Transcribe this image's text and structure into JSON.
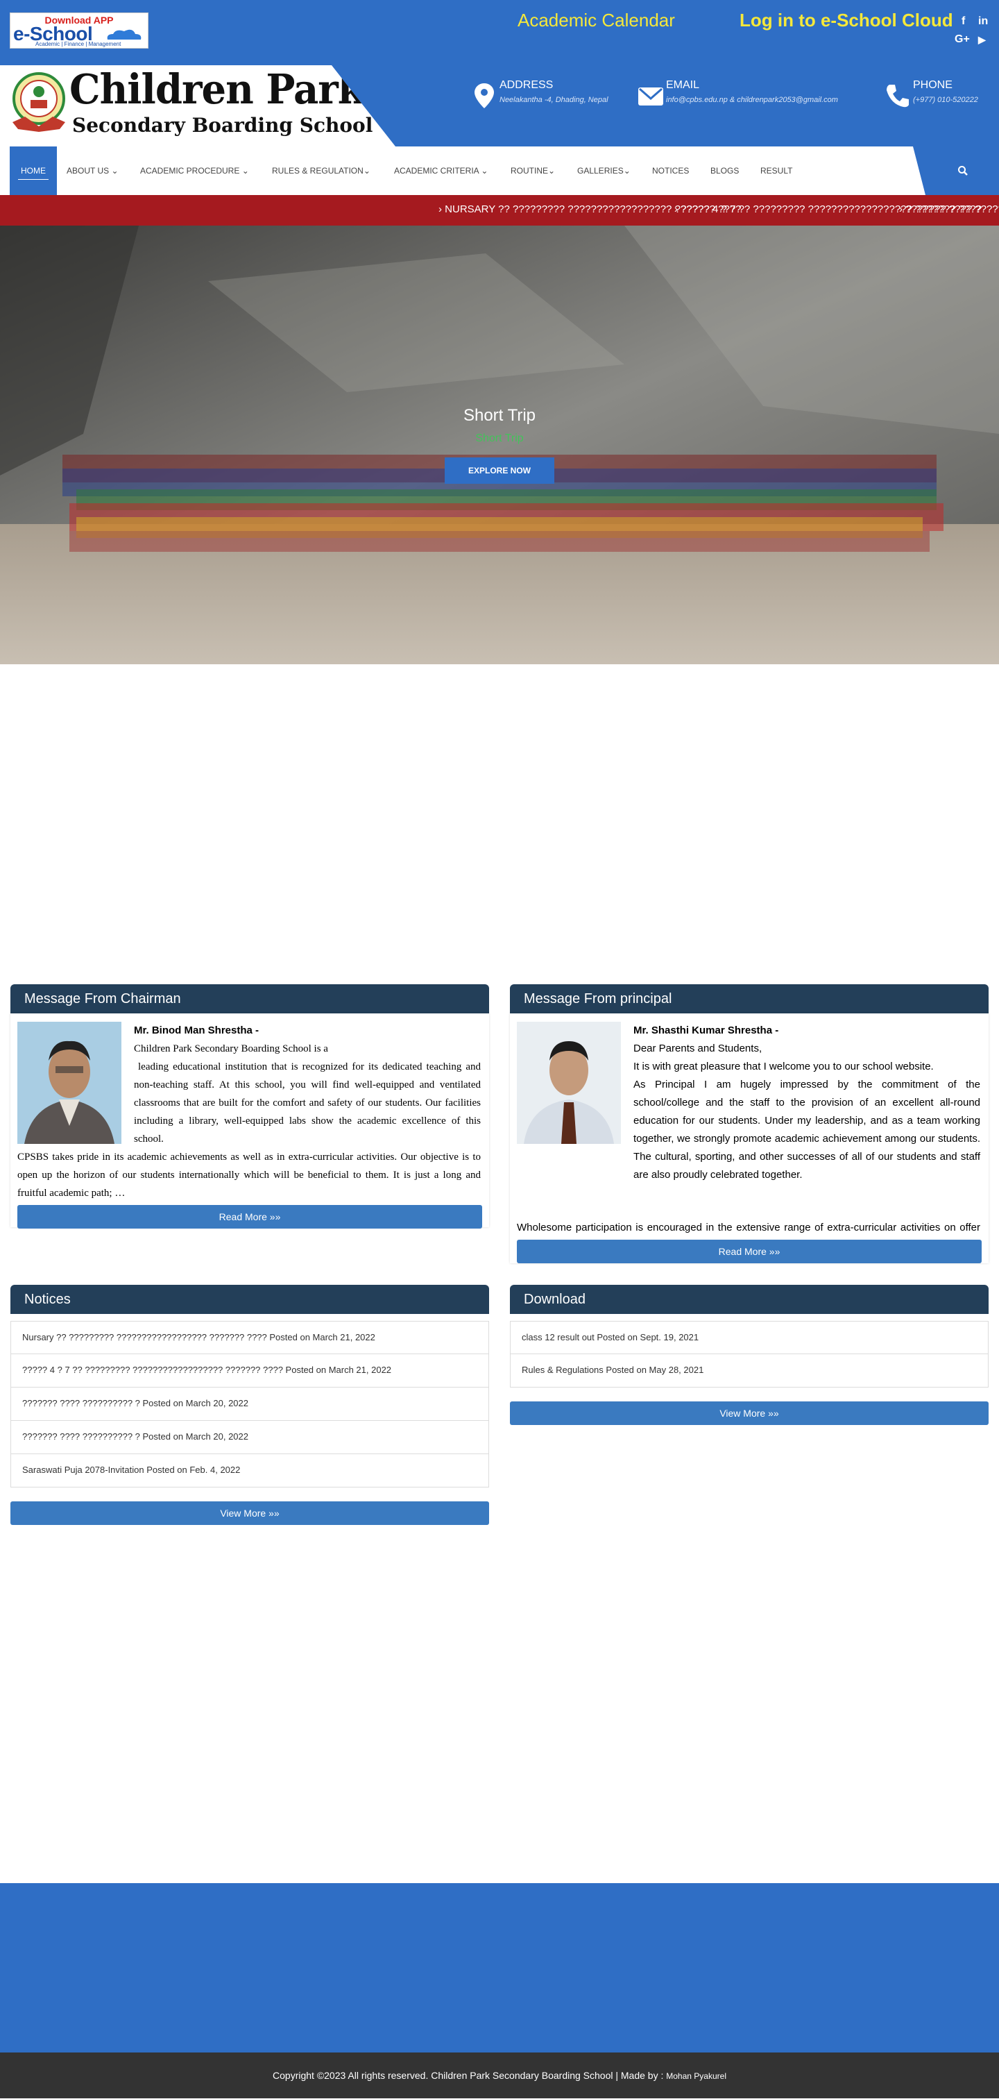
{
  "topbar": {
    "app_badge": {
      "line1": "Download APP",
      "line2": "e-School",
      "line3": "Academic | Finance | Management"
    },
    "academic_calendar": "Academic Calendar",
    "login": "Log in to e-School Cloud",
    "social": {
      "facebook": "f",
      "linkedin": "in",
      "google_plus": "G+",
      "youtube": "▶"
    }
  },
  "header": {
    "school_name_line1": "Children Park",
    "school_name_line2": "Secondary Boarding School",
    "address": {
      "title": "ADDRESS",
      "text": "Neelakantha -4, Dhading, Nepal"
    },
    "email": {
      "title": "EMAIL",
      "text": "info@cpbs.edu.np & childrenpark2053@gmail.com"
    },
    "phone": {
      "title": "PHONE",
      "text": "(+977) 010-520222"
    }
  },
  "nav": {
    "items": [
      {
        "label": "HOME",
        "active": true
      },
      {
        "label": "ABOUT US",
        "dropdown": true
      },
      {
        "label": "ACADEMIC PROCEDURE",
        "dropdown": true
      },
      {
        "label": "RULES & REGULATION",
        "dropdown": true
      },
      {
        "label": "ACADEMIC CRITERIA",
        "dropdown": true
      },
      {
        "label": "ROUTINE",
        "dropdown": true
      },
      {
        "label": "GALLERIES",
        "dropdown": true
      },
      {
        "label": "NOTICES"
      },
      {
        "label": "BLOGS"
      },
      {
        "label": "RESULT"
      }
    ],
    "search_icon": "search-icon"
  },
  "ticker": {
    "items": [
      "NURSARY ?? ????????? ?????????????????? ??????? ????",
      "????? 4 ? 7 ?? ????????? ?????????????????? ??????? ????",
      "??????? ???? ??????????"
    ]
  },
  "hero": {
    "title": "Short Trip",
    "subtitle": "Short Trip",
    "button": "EXPLORE NOW"
  },
  "chairman": {
    "heading": "Message From Chairman",
    "name": "Mr. Binod Man Shrestha -",
    "text1": "Children Park Secondary Boarding School is a",
    "text2": "leading educational institution that is recognized for its dedicated teaching and non-teaching staff. At this school, you will find well-equipped and ventilated classrooms that are built for the comfort and safety of our students. Our facilities including a library, well-equipped labs show the academic excellence of this school.",
    "text3": "CPSBS takes pride in its academic achievements as well as in extra-curricular activities. Our objective is to open up the horizon of our students internationally which will be beneficial to them. It is just a long and fruitful academic path; …",
    "button": "Read More »»"
  },
  "principal": {
    "heading": "Message From principal",
    "name": "Mr. Shasthi Kumar Shrestha -",
    "greeting": "Dear Parents and Students,",
    "text1": "It is with great pleasure that I welcome you to our school website.",
    "text2": "As Principal I am hugely impressed by the commitment of the school/college and the staff to the provision of an excellent all-round education for our students. Under my leadership, and as a team working together, we strongly promote academic achievement among our students. The cultural, sporting, and other successes of all of our students and staff are also proudly celebrated together.",
    "text3": "Wholesome participation is encouraged in the extensive range of extra-curricular activities on offer and care is also taken to ensure the well-being and …",
    "button": "Read More »»"
  },
  "notices": {
    "heading": "Notices",
    "items": [
      "Nursary ?? ????????? ?????????????????? ??????? ???? Posted on March 21, 2022",
      "????? 4 ? 7 ?? ????????? ?????????????????? ??????? ???? Posted on March 21, 2022",
      "??????? ???? ?????????? ? Posted on March 20, 2022",
      "??????? ???? ?????????? ? Posted on March 20, 2022",
      "Saraswati Puja 2078-Invitation Posted on Feb. 4, 2022"
    ],
    "button": "View More »»"
  },
  "download": {
    "heading": "Download",
    "items": [
      "class 12 result out Posted on Sept. 19, 2021",
      "Rules & Regulations Posted on May 28, 2021"
    ],
    "button": "View More »»"
  },
  "footer": {
    "copyright": "Copyright ©2023 All rights reserved. Children Park Secondary Boarding School  | Made by :",
    "author": "Mohan Pyakurel"
  }
}
